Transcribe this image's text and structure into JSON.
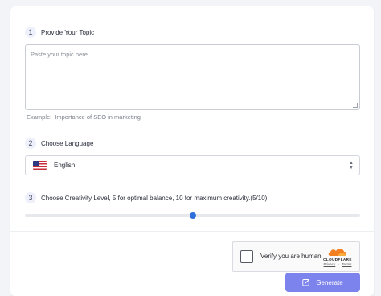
{
  "steps": [
    {
      "num": "1",
      "label": "Provide Your Topic"
    },
    {
      "num": "2",
      "label": "Choose Language"
    },
    {
      "num": "3",
      "label": "Choose Creativity Level, 5 for optimal balance, 10 for maximum creativity.(5/10)"
    }
  ],
  "topic": {
    "placeholder": "Paste your topic here",
    "value": "",
    "example_prefix": "Example:",
    "example_value": "Importance of SEO in marketing"
  },
  "language": {
    "selected": "English",
    "flag_icon": "us-flag-icon"
  },
  "creativity": {
    "value": 5,
    "min": 0,
    "max": 10
  },
  "captcha": {
    "label": "Verify you are human",
    "brand": "CLOUDFLARE",
    "privacy": "Privacy",
    "separator": "·",
    "terms": "Terms"
  },
  "generate_button": {
    "label": "Generate",
    "icon": "edit-icon"
  },
  "colors": {
    "accent": "#7d83ec",
    "slider_thumb": "#2f6fdc",
    "cloudflare_orange": "#f38020"
  }
}
